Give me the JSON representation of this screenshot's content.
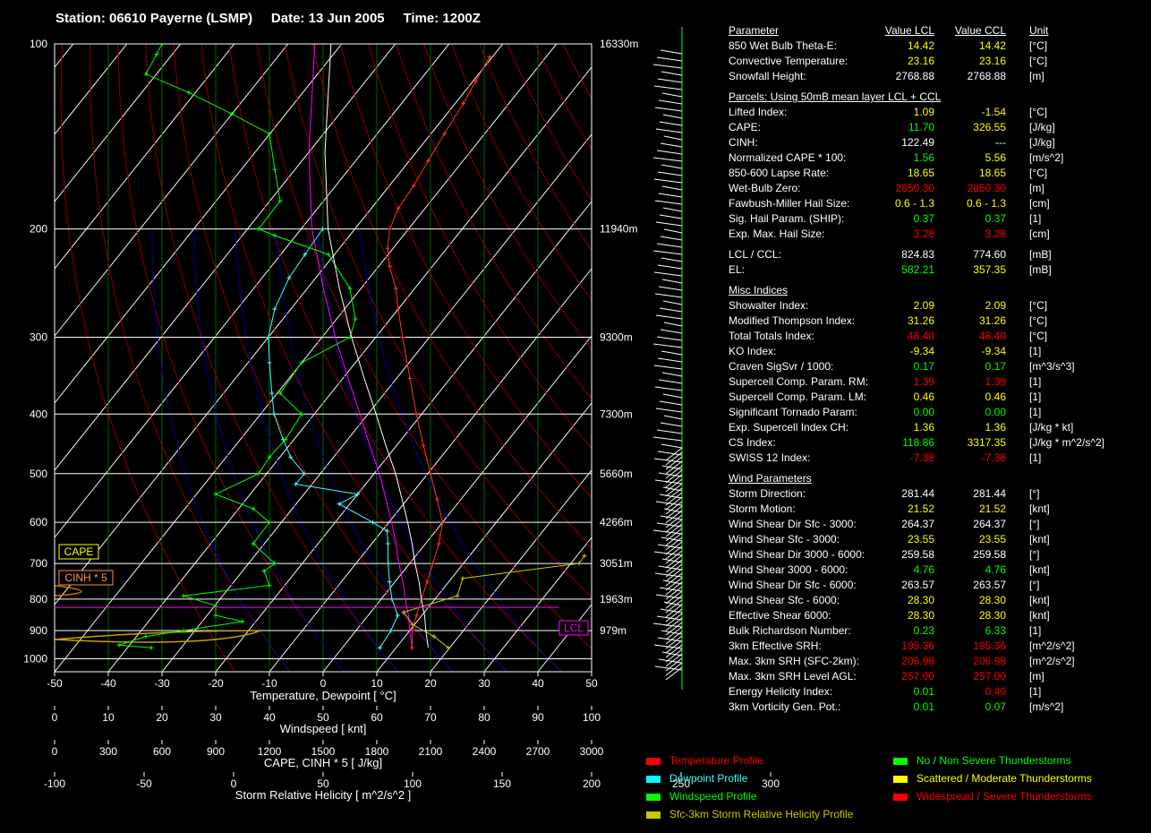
{
  "header": {
    "station": "Station: 06610 Payerne (LSMP)",
    "date": "Date: 13 Jun 2005",
    "time": "Time: 1200Z"
  },
  "chart_data": {
    "type": "skew-t",
    "pressure_levels": [
      100,
      200,
      300,
      400,
      500,
      600,
      700,
      800,
      900,
      1000
    ],
    "height_labels": [
      {
        "p": 100,
        "label": "16330m"
      },
      {
        "p": 200,
        "label": "11940m"
      },
      {
        "p": 300,
        "label": "9300m"
      },
      {
        "p": 400,
        "label": "7300m"
      },
      {
        "p": 500,
        "label": "5660m"
      },
      {
        "p": 600,
        "label": "4266m"
      },
      {
        "p": 700,
        "label": "3051m"
      },
      {
        "p": 800,
        "label": "1963m"
      },
      {
        "p": 900,
        "label": "979m"
      }
    ],
    "temperature_axis": {
      "label": "Temperature, Dewpoint  [ °C]",
      "ticks": [
        -50,
        -40,
        -30,
        -20,
        -10,
        0,
        10,
        20,
        30,
        40,
        50
      ]
    },
    "windspeed_axis": {
      "label": "Windspeed  [ knt]",
      "ticks": [
        0,
        10,
        20,
        30,
        40,
        50,
        60,
        70,
        80,
        90,
        100
      ]
    },
    "cape_axis": {
      "label": "CAPE, CINH * 5  [ J/kg]",
      "ticks": [
        0,
        300,
        600,
        900,
        1200,
        1500,
        1800,
        2100,
        2400,
        2700,
        3000
      ]
    },
    "srh_axis": {
      "label": "Storm Relative Helicity  [ m^2/s^2 ]",
      "ticks": [
        -100,
        -50,
        0,
        50,
        100,
        150,
        200,
        250,
        300
      ]
    },
    "box_labels": {
      "cape": "CAPE",
      "cinh": "CINH * 5",
      "lcl": "LCL"
    },
    "temperature_profile": [
      {
        "p": 960,
        "t": 13
      },
      {
        "p": 900,
        "t": 10.5
      },
      {
        "p": 850,
        "t": 9
      },
      {
        "p": 800,
        "t": 7.5
      },
      {
        "p": 750,
        "t": 6
      },
      {
        "p": 700,
        "t": 4.3
      },
      {
        "p": 650,
        "t": 2.5
      },
      {
        "p": 600,
        "t": 0
      },
      {
        "p": 550,
        "t": -4.5
      },
      {
        "p": 500,
        "t": -9.5
      },
      {
        "p": 450,
        "t": -15
      },
      {
        "p": 400,
        "t": -21
      },
      {
        "p": 350,
        "t": -27.5
      },
      {
        "p": 300,
        "t": -35
      },
      {
        "p": 270,
        "t": -40
      },
      {
        "p": 250,
        "t": -43.5
      },
      {
        "p": 230,
        "t": -48
      },
      {
        "p": 215,
        "t": -51
      },
      {
        "p": 200,
        "t": -53.5
      },
      {
        "p": 185,
        "t": -55
      },
      {
        "p": 170,
        "t": -55.5
      },
      {
        "p": 155,
        "t": -56.5
      },
      {
        "p": 140,
        "t": -57.5
      },
      {
        "p": 125,
        "t": -58.5
      },
      {
        "p": 115,
        "t": -59.5
      },
      {
        "p": 105,
        "t": -60.5
      }
    ],
    "dewpoint_profile": [
      {
        "p": 960,
        "t": 7
      },
      {
        "p": 900,
        "t": 6.5
      },
      {
        "p": 850,
        "t": 5.5
      },
      {
        "p": 800,
        "t": 2
      },
      {
        "p": 750,
        "t": -1
      },
      {
        "p": 700,
        "t": -4
      },
      {
        "p": 650,
        "t": -7
      },
      {
        "p": 620,
        "t": -9
      },
      {
        "p": 600,
        "t": -13
      },
      {
        "p": 560,
        "t": -22
      },
      {
        "p": 540,
        "t": -20
      },
      {
        "p": 520,
        "t": -33
      },
      {
        "p": 500,
        "t": -33
      },
      {
        "p": 470,
        "t": -38
      },
      {
        "p": 440,
        "t": -42
      },
      {
        "p": 400,
        "t": -47.5
      },
      {
        "p": 370,
        "t": -51
      },
      {
        "p": 330,
        "t": -56
      },
      {
        "p": 300,
        "t": -60
      },
      {
        "p": 270,
        "t": -63
      },
      {
        "p": 240,
        "t": -65
      },
      {
        "p": 220,
        "t": -65.5
      },
      {
        "p": 200,
        "t": -66
      }
    ],
    "parcel_profile": [
      {
        "p": 960,
        "t": 13
      },
      {
        "p": 900,
        "t": 10
      },
      {
        "p": 850,
        "t": 7.5
      },
      {
        "p": 825,
        "t": 6
      },
      {
        "p": 800,
        "t": 4.5
      },
      {
        "p": 750,
        "t": 1.5
      },
      {
        "p": 700,
        "t": -2
      },
      {
        "p": 650,
        "t": -5.5
      },
      {
        "p": 600,
        "t": -9.5
      },
      {
        "p": 550,
        "t": -14
      },
      {
        "p": 500,
        "t": -19
      },
      {
        "p": 450,
        "t": -25
      },
      {
        "p": 400,
        "t": -31.5
      },
      {
        "p": 350,
        "t": -39
      },
      {
        "p": 300,
        "t": -47.5
      },
      {
        "p": 250,
        "t": -57
      },
      {
        "p": 200,
        "t": -68
      },
      {
        "p": 150,
        "t": -80
      },
      {
        "p": 100,
        "t": -95
      }
    ],
    "windspeed_profile": [
      {
        "p": 960,
        "ws": 18
      },
      {
        "p": 950,
        "ws": 12
      },
      {
        "p": 920,
        "ws": 17
      },
      {
        "p": 900,
        "ws": 24
      },
      {
        "p": 870,
        "ws": 35
      },
      {
        "p": 850,
        "ws": 30
      },
      {
        "p": 820,
        "ws": 30
      },
      {
        "p": 790,
        "ws": 24
      },
      {
        "p": 760,
        "ws": 40
      },
      {
        "p": 720,
        "ws": 39
      },
      {
        "p": 700,
        "ws": 41
      },
      {
        "p": 650,
        "ws": 37
      },
      {
        "p": 600,
        "ws": 40
      },
      {
        "p": 570,
        "ws": 37
      },
      {
        "p": 540,
        "ws": 30
      },
      {
        "p": 500,
        "ws": 38
      },
      {
        "p": 470,
        "ws": 40
      },
      {
        "p": 440,
        "ws": 43
      },
      {
        "p": 400,
        "ws": 46
      },
      {
        "p": 370,
        "ws": 42
      },
      {
        "p": 330,
        "ws": 46
      },
      {
        "p": 300,
        "ws": 55
      },
      {
        "p": 280,
        "ws": 56
      },
      {
        "p": 250,
        "ws": 55
      },
      {
        "p": 220,
        "ws": 51
      },
      {
        "p": 205,
        "ws": 41
      },
      {
        "p": 200,
        "ws": 38
      },
      {
        "p": 180,
        "ws": 42
      },
      {
        "p": 160,
        "ws": 41
      },
      {
        "p": 140,
        "ws": 40
      },
      {
        "p": 130,
        "ws": 33
      },
      {
        "p": 120,
        "ws": 25
      },
      {
        "p": 112,
        "ws": 17
      },
      {
        "p": 104,
        "ws": 19
      },
      {
        "p": 100,
        "ws": 20
      }
    ],
    "srh_profile": [
      {
        "p": 960,
        "srh": 120
      },
      {
        "p": 920,
        "srh": 112
      },
      {
        "p": 880,
        "srh": 100
      },
      {
        "p": 840,
        "srh": 95
      },
      {
        "p": 790,
        "srh": 125
      },
      {
        "p": 740,
        "srh": 128
      },
      {
        "p": 700,
        "srh": 193
      },
      {
        "p": 680,
        "srh": 196
      }
    ],
    "legend": [
      {
        "label": "Temperature Profile",
        "color": "#ff0000"
      },
      {
        "label": "Dewpoint Profile",
        "color": "#00ffff"
      },
      {
        "label": "Windspeed Profile",
        "color": "#00ff00"
      },
      {
        "label": "Sfc-3km Storm Relative Helicity Profile",
        "color": "#c8c800"
      },
      {
        "label": "No / Non Severe Thunderstorms",
        "color": "#00ff00"
      },
      {
        "label": "Scattered / Moderate Thunderstorms",
        "color": "#ffff00"
      },
      {
        "label": "Widespread / Severe Thunderstorms",
        "color": "#ff0000"
      }
    ]
  },
  "params": {
    "header": {
      "label": "Parameter",
      "v1": "Value LCL",
      "v2": "Value CCL",
      "unit": "Unit"
    },
    "rows": [
      {
        "label": "850 Wet Bulb Theta-E:",
        "v1": "14.42",
        "v2": "14.42",
        "unit": "[°C]",
        "c1": "#ffff00",
        "c2": "#ffff00"
      },
      {
        "label": "Convective Temperature:",
        "v1": "23.16",
        "v2": "23.16",
        "unit": "[°C]",
        "c1": "#ffff00",
        "c2": "#ffff00"
      },
      {
        "label": "Snowfall Height:",
        "v1": "2768.88",
        "v2": "2768.88",
        "unit": "[m]",
        "c1": "#ffffff",
        "c2": "#ffffff"
      },
      {
        "section": "Parcels: Using 50mB mean layer LCL + CCL"
      },
      {
        "label": "Lifted Index:",
        "v1": "1.09",
        "v2": "-1.54",
        "unit": "[°C]",
        "c1": "#ffff00",
        "c2": "#ffff00"
      },
      {
        "label": "CAPE:",
        "v1": "11.70",
        "v2": "326.55",
        "unit": "[J/kg]",
        "c1": "#00ff00",
        "c2": "#ffff00"
      },
      {
        "label": "CINH:",
        "v1": "122.49",
        "v2": "---",
        "unit": "[J/kg]",
        "c1": "#ffffff",
        "c2": "#ffffff"
      },
      {
        "label": "Normalized CAPE * 100:",
        "v1": "1.56",
        "v2": "5.56",
        "unit": "[m/s^2]",
        "c1": "#00ff00",
        "c2": "#ffff00"
      },
      {
        "label": "850-600 Lapse Rate:",
        "v1": "18.65",
        "v2": "18.65",
        "unit": "[°C]",
        "c1": "#ffff00",
        "c2": "#ffff00"
      },
      {
        "label": "Wet-Bulb Zero:",
        "v1": "2850.30",
        "v2": "2850.30",
        "unit": "[m]",
        "c1": "#ff0000",
        "c2": "#ff0000"
      },
      {
        "label": "Fawbush-Miller Hail Size:",
        "v1": "0.6 - 1.3",
        "v2": "0.6 - 1.3",
        "unit": "[cm]",
        "c1": "#ffff00",
        "c2": "#ffff00"
      },
      {
        "label": "Sig. Hail Param. (SHIP):",
        "v1": "0.37",
        "v2": "0.37",
        "unit": "[1]",
        "c1": "#00ff00",
        "c2": "#00ff00"
      },
      {
        "label": "Exp. Max. Hail Size:",
        "v1": "3.28",
        "v2": "3.28",
        "unit": "[cm]",
        "c1": "#ff0000",
        "c2": "#ff0000"
      },
      {
        "gap": true
      },
      {
        "label": "LCL / CCL:",
        "v1": "824.83",
        "v2": "774.60",
        "unit": "[mB]",
        "c1": "#ffffff",
        "c2": "#ffffff"
      },
      {
        "label": "EL:",
        "v1": "582.21",
        "v2": "357.35",
        "unit": "[mB]",
        "c1": "#00ff00",
        "c2": "#ffff00"
      },
      {
        "section": "Misc Indices"
      },
      {
        "label": "Showalter Index:",
        "v1": "2.09",
        "v2": "2.09",
        "unit": "[°C]",
        "c1": "#ffff00",
        "c2": "#ffff00"
      },
      {
        "label": "Modified Thompson Index:",
        "v1": "31.26",
        "v2": "31.26",
        "unit": "[°C]",
        "c1": "#ffff00",
        "c2": "#ffff00"
      },
      {
        "label": "Total Totals Index:",
        "v1": "48.40",
        "v2": "48.40",
        "unit": "[°C]",
        "c1": "#ff0000",
        "c2": "#ff0000"
      },
      {
        "label": "KO Index:",
        "v1": "-9.34",
        "v2": "-9.34",
        "unit": "[1]",
        "c1": "#ffff00",
        "c2": "#ffff00"
      },
      {
        "label": "Craven SigSvr / 1000:",
        "v1": "0.17",
        "v2": "0.17",
        "unit": "[m^3/s^3]",
        "c1": "#00ff00",
        "c2": "#00ff00"
      },
      {
        "label": "Supercell Comp. Param. RM:",
        "v1": "1.39",
        "v2": "1.39",
        "unit": "[1]",
        "c1": "#ff0000",
        "c2": "#ff0000"
      },
      {
        "label": "Supercell Comp. Param. LM:",
        "v1": "0.46",
        "v2": "0.46",
        "unit": "[1]",
        "c1": "#ffff00",
        "c2": "#ffff00"
      },
      {
        "label": "Significant Tornado Param:",
        "v1": "0.00",
        "v2": "0.00",
        "unit": "[1]",
        "c1": "#00ff00",
        "c2": "#00ff00"
      },
      {
        "label": "Exp. Supercell Index CH:",
        "v1": "1.36",
        "v2": "1.36",
        "unit": "[J/kg * kt]",
        "c1": "#ffff00",
        "c2": "#ffff00"
      },
      {
        "label": "CS Index:",
        "v1": "118.86",
        "v2": "3317.35",
        "unit": "[J/kg * m^2/s^2]",
        "c1": "#00ff00",
        "c2": "#ffff00"
      },
      {
        "label": "SWISS 12 Index:",
        "v1": "-7.38",
        "v2": "-7.38",
        "unit": "[1]",
        "c1": "#ff0000",
        "c2": "#ff0000"
      },
      {
        "section": "Wind Parameters"
      },
      {
        "label": "Storm Direction:",
        "v1": "281.44",
        "v2": "281.44",
        "unit": "[°]",
        "c1": "#ffffff",
        "c2": "#ffffff"
      },
      {
        "label": "Storm Motion:",
        "v1": "21.52",
        "v2": "21.52",
        "unit": "[knt]",
        "c1": "#ffff00",
        "c2": "#ffff00"
      },
      {
        "label": "Wind Shear Dir Sfc - 3000:",
        "v1": "264.37",
        "v2": "264.37",
        "unit": "[°]",
        "c1": "#ffffff",
        "c2": "#ffffff"
      },
      {
        "label": "Wind Shear Sfc - 3000:",
        "v1": "23.55",
        "v2": "23.55",
        "unit": "[knt]",
        "c1": "#ffff00",
        "c2": "#ffff00"
      },
      {
        "label": "Wind Shear Dir 3000 - 6000:",
        "v1": "259.58",
        "v2": "259.58",
        "unit": "[°]",
        "c1": "#ffffff",
        "c2": "#ffffff"
      },
      {
        "label": "Wind Shear 3000 - 6000:",
        "v1": "4.76",
        "v2": "4.76",
        "unit": "[knt]",
        "c1": "#00ff00",
        "c2": "#00ff00"
      },
      {
        "label": "Wind Shear Dir Sfc - 6000:",
        "v1": "263.57",
        "v2": "263.57",
        "unit": "[°]",
        "c1": "#ffffff",
        "c2": "#ffffff"
      },
      {
        "label": "Wind Shear Sfc - 6000:",
        "v1": "28.30",
        "v2": "28.30",
        "unit": "[knt]",
        "c1": "#ffff00",
        "c2": "#ffff00"
      },
      {
        "label": "Effective Shear 6000:",
        "v1": "28.30",
        "v2": "28.30",
        "unit": "[knt]",
        "c1": "#ffff00",
        "c2": "#ffff00"
      },
      {
        "label": "Bulk Richardson Number:",
        "v1": "0.23",
        "v2": "6.33",
        "unit": "[1]",
        "c1": "#00ff00",
        "c2": "#00ff00"
      },
      {
        "label": "3km Effective SRH:",
        "v1": "195.36",
        "v2": "195.36",
        "unit": "[m^2/s^2]",
        "c1": "#ff0000",
        "c2": "#ff0000"
      },
      {
        "label": "Max. 3km SRH (SFC-2km):",
        "v1": "206.98",
        "v2": "206.98",
        "unit": "[m^2/s^2]",
        "c1": "#ff0000",
        "c2": "#ff0000"
      },
      {
        "label": "Max. 3km SRH Level AGL:",
        "v1": "257.00",
        "v2": "257.00",
        "unit": "[m]",
        "c1": "#ff0000",
        "c2": "#ff0000"
      },
      {
        "label": "Energy Helicity Index:",
        "v1": "0.01",
        "v2": "0.40",
        "unit": "[1]",
        "c1": "#00ff00",
        "c2": "#ff0000"
      },
      {
        "label": "3km Vorticity Gen. Pot.:",
        "v1": "0.01",
        "v2": "0.07",
        "unit": "[m/s^2]",
        "c1": "#00ff00",
        "c2": "#00ff00"
      }
    ]
  }
}
